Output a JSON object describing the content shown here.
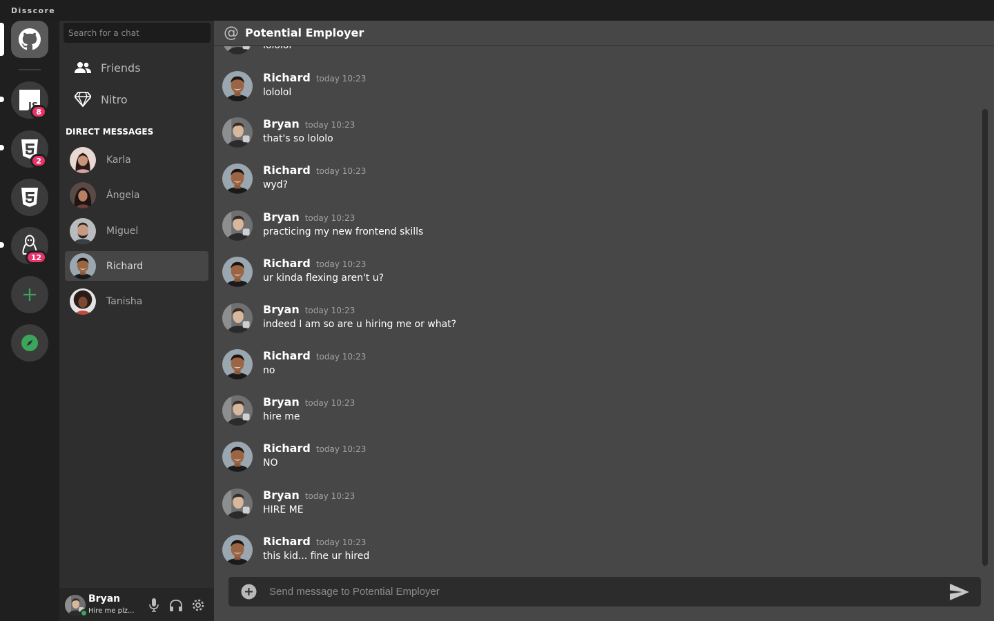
{
  "app": {
    "title": "Disscore"
  },
  "servers": [
    {
      "name": "github",
      "badge": ""
    },
    {
      "name": "javascript",
      "badge": "8"
    },
    {
      "name": "html5",
      "badge": "2"
    },
    {
      "name": "css3",
      "badge": ""
    },
    {
      "name": "linux",
      "badge": "12"
    }
  ],
  "search": {
    "placeholder": "Search for a chat"
  },
  "nav": {
    "friends": "Friends",
    "nitro": "Nitro"
  },
  "dm_heading": "DIRECT MESSAGES",
  "dms": [
    "Karla",
    "Ángela",
    "Miguel",
    "Richard",
    "Tanisha"
  ],
  "active_dm": "Richard",
  "user": {
    "name": "Bryan",
    "status": "Hire me plz..."
  },
  "chat": {
    "channel": "Potential Employer",
    "partial_message": "lololol",
    "messages": [
      {
        "author": "Richard",
        "time": "today 10:23",
        "text": "lololol"
      },
      {
        "author": "Bryan",
        "time": "today 10:23",
        "text": "that's so lololo"
      },
      {
        "author": "Richard",
        "time": "today 10:23",
        "text": "wyd?"
      },
      {
        "author": "Bryan",
        "time": "today 10:23",
        "text": "practicing my new frontend skills"
      },
      {
        "author": "Richard",
        "time": "today 10:23",
        "text": "ur kinda flexing aren't u?"
      },
      {
        "author": "Bryan",
        "time": "today 10:23",
        "text": "indeed I am so are u hiring me or what?"
      },
      {
        "author": "Richard",
        "time": "today 10:23",
        "text": "no"
      },
      {
        "author": "Bryan",
        "time": "today 10:23",
        "text": "hire me"
      },
      {
        "author": "Richard",
        "time": "today 10:23",
        "text": "NO"
      },
      {
        "author": "Bryan",
        "time": "today 10:23",
        "text": "HIRE ME"
      },
      {
        "author": "Richard",
        "time": "today 10:23",
        "text": "this kid... fine ur hired"
      }
    ],
    "composer_placeholder": "Send message to Potential Employer"
  },
  "colors": {
    "accent_green": "#3ba55c",
    "badge_pink": "#e8336b"
  }
}
